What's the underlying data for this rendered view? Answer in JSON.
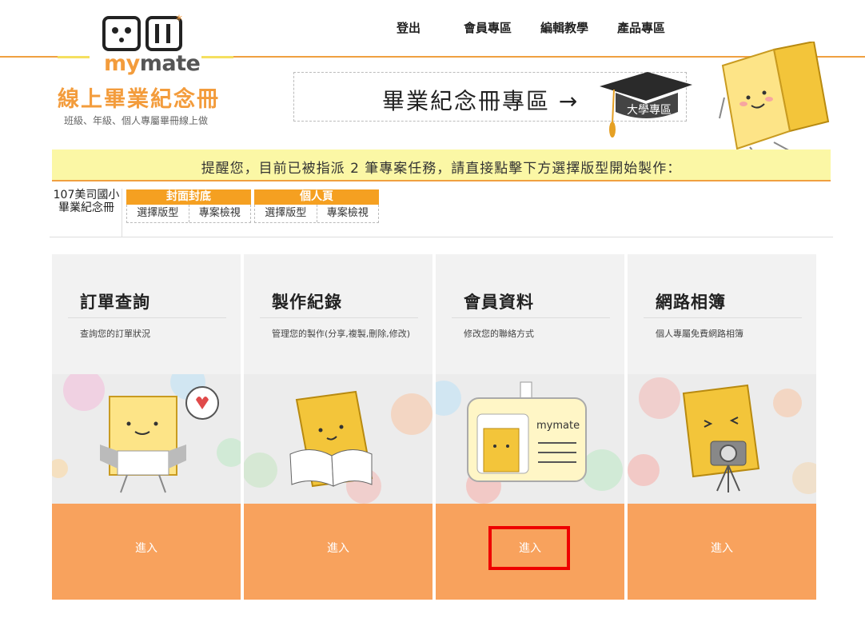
{
  "brand": {
    "logo_text_a": "my",
    "logo_text_b": "mate",
    "site_title": "線上畢業紀念冊",
    "site_sub": "班級、年級、個人專屬畢冊線上做"
  },
  "nav": [
    {
      "label": "登出"
    },
    {
      "label": "會員專區"
    },
    {
      "label": "編輯教學"
    },
    {
      "label": "產品專區"
    }
  ],
  "banner": {
    "text": "畢業紀念冊專區 →",
    "badge": "大學專區"
  },
  "reminder": "提醒您，目前已被指派 2 筆專案任務，請直接點擊下方選擇版型開始製作：",
  "project": {
    "name": "107美司國小畢業紀念冊",
    "groups": [
      {
        "title": "封面封底",
        "buttons": [
          "選擇版型",
          "專案檢視"
        ]
      },
      {
        "title": "個人頁",
        "buttons": [
          "選擇版型",
          "專案檢視"
        ]
      }
    ]
  },
  "cards": [
    {
      "title": "訂單查詢",
      "desc": "查詢您的訂單狀況",
      "button": "進入",
      "icon": "mascot-box-heart-icon"
    },
    {
      "title": "製作紀錄",
      "desc": "管理您的製作(分享,複製,刪除,修改)",
      "button": "進入",
      "icon": "mascot-reading-book-icon"
    },
    {
      "title": "會員資料",
      "desc": "修改您的聯絡方式",
      "button": "進入",
      "icon": "mascot-id-badge-icon"
    },
    {
      "title": "網路相簿",
      "desc": "個人專屬免費網路相簿",
      "button": "進入",
      "icon": "mascot-camera-icon"
    }
  ],
  "colors": {
    "accent": "#f39c3c",
    "button": "#f8a25d",
    "reminder_bg": "#fbf7a5",
    "highlight": "#e00000"
  }
}
